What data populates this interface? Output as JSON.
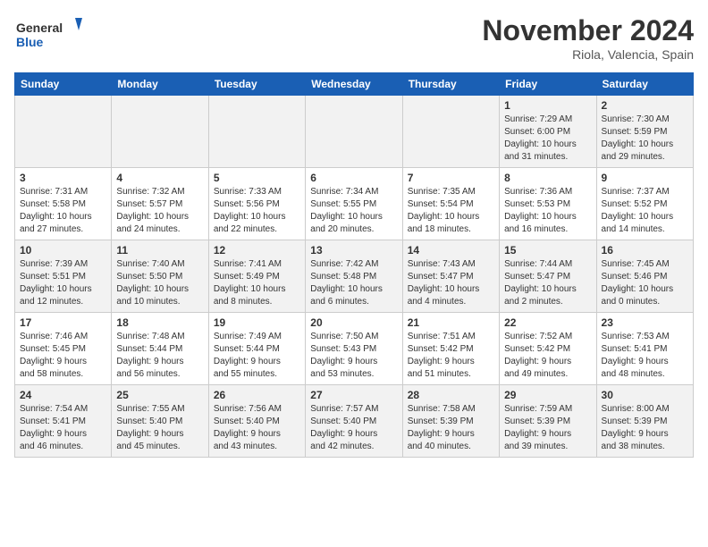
{
  "header": {
    "logo_line1": "General",
    "logo_line2": "Blue",
    "month_title": "November 2024",
    "location": "Riola, Valencia, Spain"
  },
  "weekdays": [
    "Sunday",
    "Monday",
    "Tuesday",
    "Wednesday",
    "Thursday",
    "Friday",
    "Saturday"
  ],
  "weeks": [
    [
      {
        "day": "",
        "info": ""
      },
      {
        "day": "",
        "info": ""
      },
      {
        "day": "",
        "info": ""
      },
      {
        "day": "",
        "info": ""
      },
      {
        "day": "",
        "info": ""
      },
      {
        "day": "1",
        "info": "Sunrise: 7:29 AM\nSunset: 6:00 PM\nDaylight: 10 hours\nand 31 minutes."
      },
      {
        "day": "2",
        "info": "Sunrise: 7:30 AM\nSunset: 5:59 PM\nDaylight: 10 hours\nand 29 minutes."
      }
    ],
    [
      {
        "day": "3",
        "info": "Sunrise: 7:31 AM\nSunset: 5:58 PM\nDaylight: 10 hours\nand 27 minutes."
      },
      {
        "day": "4",
        "info": "Sunrise: 7:32 AM\nSunset: 5:57 PM\nDaylight: 10 hours\nand 24 minutes."
      },
      {
        "day": "5",
        "info": "Sunrise: 7:33 AM\nSunset: 5:56 PM\nDaylight: 10 hours\nand 22 minutes."
      },
      {
        "day": "6",
        "info": "Sunrise: 7:34 AM\nSunset: 5:55 PM\nDaylight: 10 hours\nand 20 minutes."
      },
      {
        "day": "7",
        "info": "Sunrise: 7:35 AM\nSunset: 5:54 PM\nDaylight: 10 hours\nand 18 minutes."
      },
      {
        "day": "8",
        "info": "Sunrise: 7:36 AM\nSunset: 5:53 PM\nDaylight: 10 hours\nand 16 minutes."
      },
      {
        "day": "9",
        "info": "Sunrise: 7:37 AM\nSunset: 5:52 PM\nDaylight: 10 hours\nand 14 minutes."
      }
    ],
    [
      {
        "day": "10",
        "info": "Sunrise: 7:39 AM\nSunset: 5:51 PM\nDaylight: 10 hours\nand 12 minutes."
      },
      {
        "day": "11",
        "info": "Sunrise: 7:40 AM\nSunset: 5:50 PM\nDaylight: 10 hours\nand 10 minutes."
      },
      {
        "day": "12",
        "info": "Sunrise: 7:41 AM\nSunset: 5:49 PM\nDaylight: 10 hours\nand 8 minutes."
      },
      {
        "day": "13",
        "info": "Sunrise: 7:42 AM\nSunset: 5:48 PM\nDaylight: 10 hours\nand 6 minutes."
      },
      {
        "day": "14",
        "info": "Sunrise: 7:43 AM\nSunset: 5:47 PM\nDaylight: 10 hours\nand 4 minutes."
      },
      {
        "day": "15",
        "info": "Sunrise: 7:44 AM\nSunset: 5:47 PM\nDaylight: 10 hours\nand 2 minutes."
      },
      {
        "day": "16",
        "info": "Sunrise: 7:45 AM\nSunset: 5:46 PM\nDaylight: 10 hours\nand 0 minutes."
      }
    ],
    [
      {
        "day": "17",
        "info": "Sunrise: 7:46 AM\nSunset: 5:45 PM\nDaylight: 9 hours\nand 58 minutes."
      },
      {
        "day": "18",
        "info": "Sunrise: 7:48 AM\nSunset: 5:44 PM\nDaylight: 9 hours\nand 56 minutes."
      },
      {
        "day": "19",
        "info": "Sunrise: 7:49 AM\nSunset: 5:44 PM\nDaylight: 9 hours\nand 55 minutes."
      },
      {
        "day": "20",
        "info": "Sunrise: 7:50 AM\nSunset: 5:43 PM\nDaylight: 9 hours\nand 53 minutes."
      },
      {
        "day": "21",
        "info": "Sunrise: 7:51 AM\nSunset: 5:42 PM\nDaylight: 9 hours\nand 51 minutes."
      },
      {
        "day": "22",
        "info": "Sunrise: 7:52 AM\nSunset: 5:42 PM\nDaylight: 9 hours\nand 49 minutes."
      },
      {
        "day": "23",
        "info": "Sunrise: 7:53 AM\nSunset: 5:41 PM\nDaylight: 9 hours\nand 48 minutes."
      }
    ],
    [
      {
        "day": "24",
        "info": "Sunrise: 7:54 AM\nSunset: 5:41 PM\nDaylight: 9 hours\nand 46 minutes."
      },
      {
        "day": "25",
        "info": "Sunrise: 7:55 AM\nSunset: 5:40 PM\nDaylight: 9 hours\nand 45 minutes."
      },
      {
        "day": "26",
        "info": "Sunrise: 7:56 AM\nSunset: 5:40 PM\nDaylight: 9 hours\nand 43 minutes."
      },
      {
        "day": "27",
        "info": "Sunrise: 7:57 AM\nSunset: 5:40 PM\nDaylight: 9 hours\nand 42 minutes."
      },
      {
        "day": "28",
        "info": "Sunrise: 7:58 AM\nSunset: 5:39 PM\nDaylight: 9 hours\nand 40 minutes."
      },
      {
        "day": "29",
        "info": "Sunrise: 7:59 AM\nSunset: 5:39 PM\nDaylight: 9 hours\nand 39 minutes."
      },
      {
        "day": "30",
        "info": "Sunrise: 8:00 AM\nSunset: 5:39 PM\nDaylight: 9 hours\nand 38 minutes."
      }
    ]
  ]
}
